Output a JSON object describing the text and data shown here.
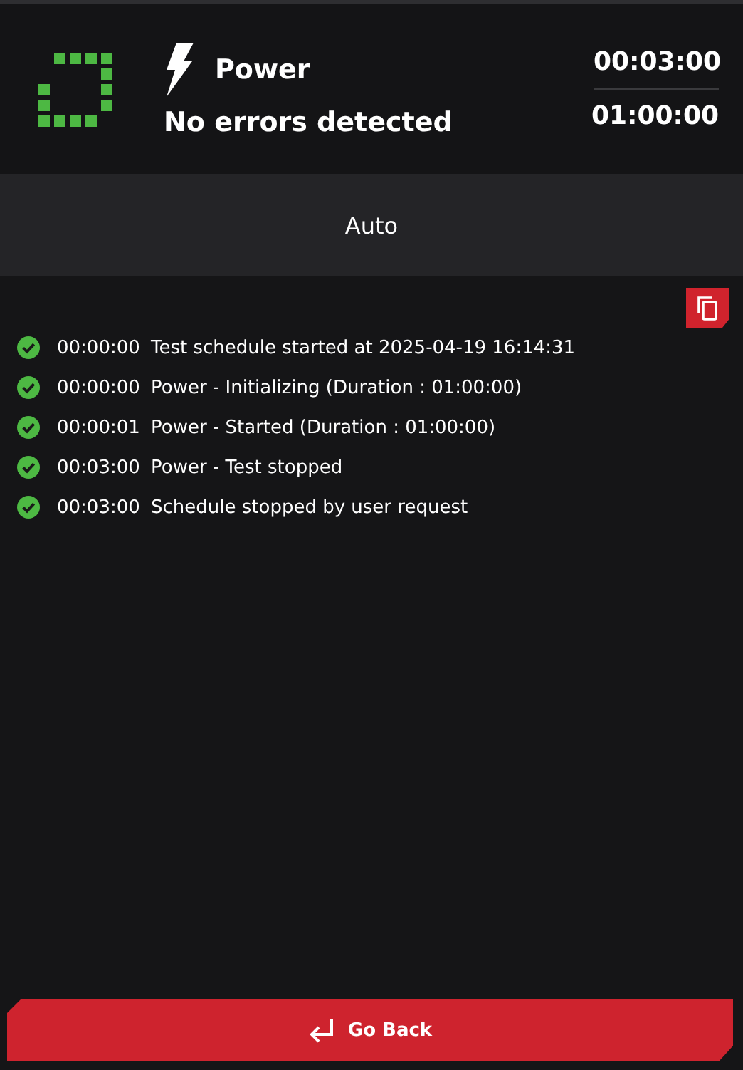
{
  "header": {
    "test_name": "Power",
    "status_text": "No errors detected",
    "elapsed": "00:03:00",
    "duration": "01:00:00"
  },
  "mode": {
    "label": "Auto"
  },
  "log": [
    {
      "time": "00:00:00",
      "message": "Test schedule started at 2025-04-19 16:14:31",
      "passed": true
    },
    {
      "time": "00:00:00",
      "message": "Power - Initializing (Duration : 01:00:00)",
      "passed": true
    },
    {
      "time": "00:00:01",
      "message": "Power - Started (Duration : 01:00:00)",
      "passed": true
    },
    {
      "time": "00:03:00",
      "message": "Power - Test stopped",
      "passed": true
    },
    {
      "time": "00:03:00",
      "message": "Schedule stopped by user request",
      "passed": true
    }
  ],
  "footer": {
    "button": "Go Back"
  }
}
